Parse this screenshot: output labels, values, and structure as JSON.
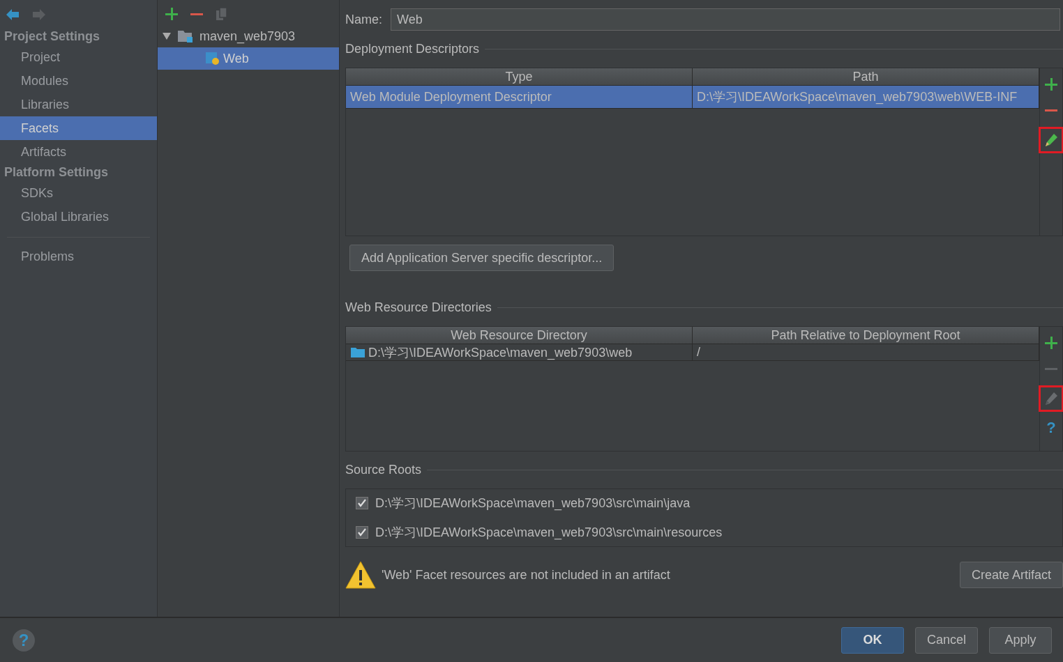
{
  "nav": [
    {
      "kind": "back",
      "disabled": false
    },
    {
      "kind": "forward",
      "disabled": true
    }
  ],
  "sidebar": {
    "sections": [
      {
        "title": "Project Settings",
        "items": [
          {
            "label": "Project",
            "selected": false
          },
          {
            "label": "Modules",
            "selected": false
          },
          {
            "label": "Libraries",
            "selected": false
          },
          {
            "label": "Facets",
            "selected": true
          },
          {
            "label": "Artifacts",
            "selected": false
          }
        ]
      },
      {
        "title": "Platform Settings",
        "items": [
          {
            "label": "SDKs",
            "selected": false
          },
          {
            "label": "Global Libraries",
            "selected": false
          }
        ]
      }
    ],
    "extra": [
      {
        "label": "Problems",
        "selected": false
      }
    ]
  },
  "tree": {
    "toolbar": [
      {
        "kind": "add",
        "disabled": false
      },
      {
        "kind": "remove",
        "disabled": false
      },
      {
        "kind": "copy",
        "disabled": true
      }
    ],
    "nodes": [
      {
        "label": "maven_web7903",
        "kind": "module",
        "expanded": true,
        "selected": false,
        "children": [
          {
            "label": "Web",
            "kind": "web-facet",
            "selected": true
          }
        ]
      }
    ]
  },
  "name_field": {
    "label": "Name:",
    "value": "Web"
  },
  "deployment_descriptors": {
    "title": "Deployment Descriptors",
    "columns": [
      "Type",
      "Path"
    ],
    "rows": [
      {
        "cells": [
          "Web Module Deployment Descriptor",
          "D:\\学习\\IDEAWorkSpace\\maven_web7903\\web\\WEB-INF"
        ],
        "selected": true
      }
    ],
    "tools": [
      {
        "kind": "add",
        "disabled": false,
        "highlighted": false
      },
      {
        "kind": "remove",
        "disabled": false,
        "highlighted": false
      },
      {
        "kind": "edit",
        "disabled": false,
        "highlighted": true
      }
    ],
    "button": "Add Application Server specific descriptor..."
  },
  "web_resource_directories": {
    "title": "Web Resource Directories",
    "columns": [
      "Web Resource Directory",
      "Path Relative to Deployment Root"
    ],
    "rows": [
      {
        "cells": [
          "D:\\学习\\IDEAWorkSpace\\maven_web7903\\web",
          "/"
        ],
        "selected": false
      }
    ],
    "tools": [
      {
        "kind": "add",
        "disabled": false,
        "highlighted": false
      },
      {
        "kind": "remove",
        "disabled": true,
        "highlighted": false
      },
      {
        "kind": "edit",
        "disabled": true,
        "highlighted": true
      },
      {
        "kind": "help",
        "disabled": false,
        "highlighted": false,
        "glyph": "?"
      }
    ]
  },
  "source_roots": {
    "title": "Source Roots",
    "items": [
      {
        "path": "D:\\学习\\IDEAWorkSpace\\maven_web7903\\src\\main\\java",
        "checked": true
      },
      {
        "path": "D:\\学习\\IDEAWorkSpace\\maven_web7903\\src\\main\\resources",
        "checked": true
      }
    ]
  },
  "warning": {
    "text": "'Web' Facet resources are not included in an artifact",
    "button": "Create Artifact"
  },
  "footer": {
    "help": "?",
    "buttons": [
      {
        "label": "OK",
        "kind": "primary"
      },
      {
        "label": "Cancel",
        "kind": "default"
      },
      {
        "label": "Apply",
        "kind": "default"
      }
    ]
  }
}
